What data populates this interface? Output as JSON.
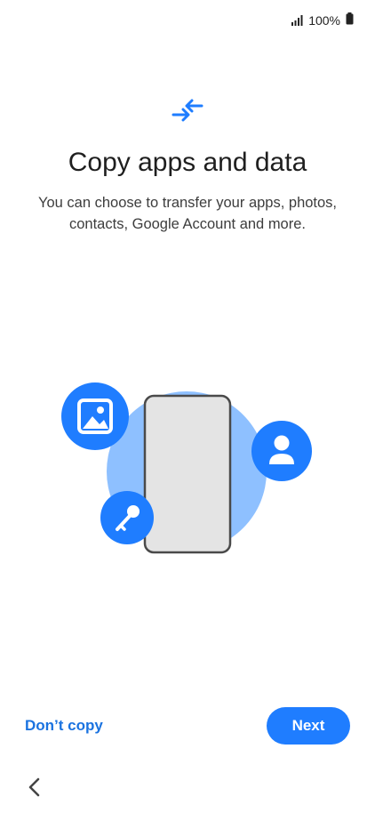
{
  "status_bar": {
    "battery_text": "100%",
    "icons": [
      "signal-icon",
      "battery-icon"
    ]
  },
  "header": {
    "icon": "transfer-arrows-icon",
    "title": "Copy apps and data",
    "subtitle": "You can choose to transfer your apps, photos, contacts, Google Account and more."
  },
  "illustration": {
    "icons": [
      "gallery-icon",
      "key-icon",
      "person-icon",
      "phone-icon"
    ]
  },
  "actions": {
    "dont_copy_label": "Don’t copy",
    "next_label": "Next"
  },
  "colors": {
    "accent": "#1f7dff",
    "link": "#1b73e0",
    "light_blue": "#8ec0ff",
    "phone_fill": "#e4e4e4",
    "phone_stroke": "#4a4a4a"
  },
  "nav": {
    "back_icon": "chevron-left-icon"
  }
}
